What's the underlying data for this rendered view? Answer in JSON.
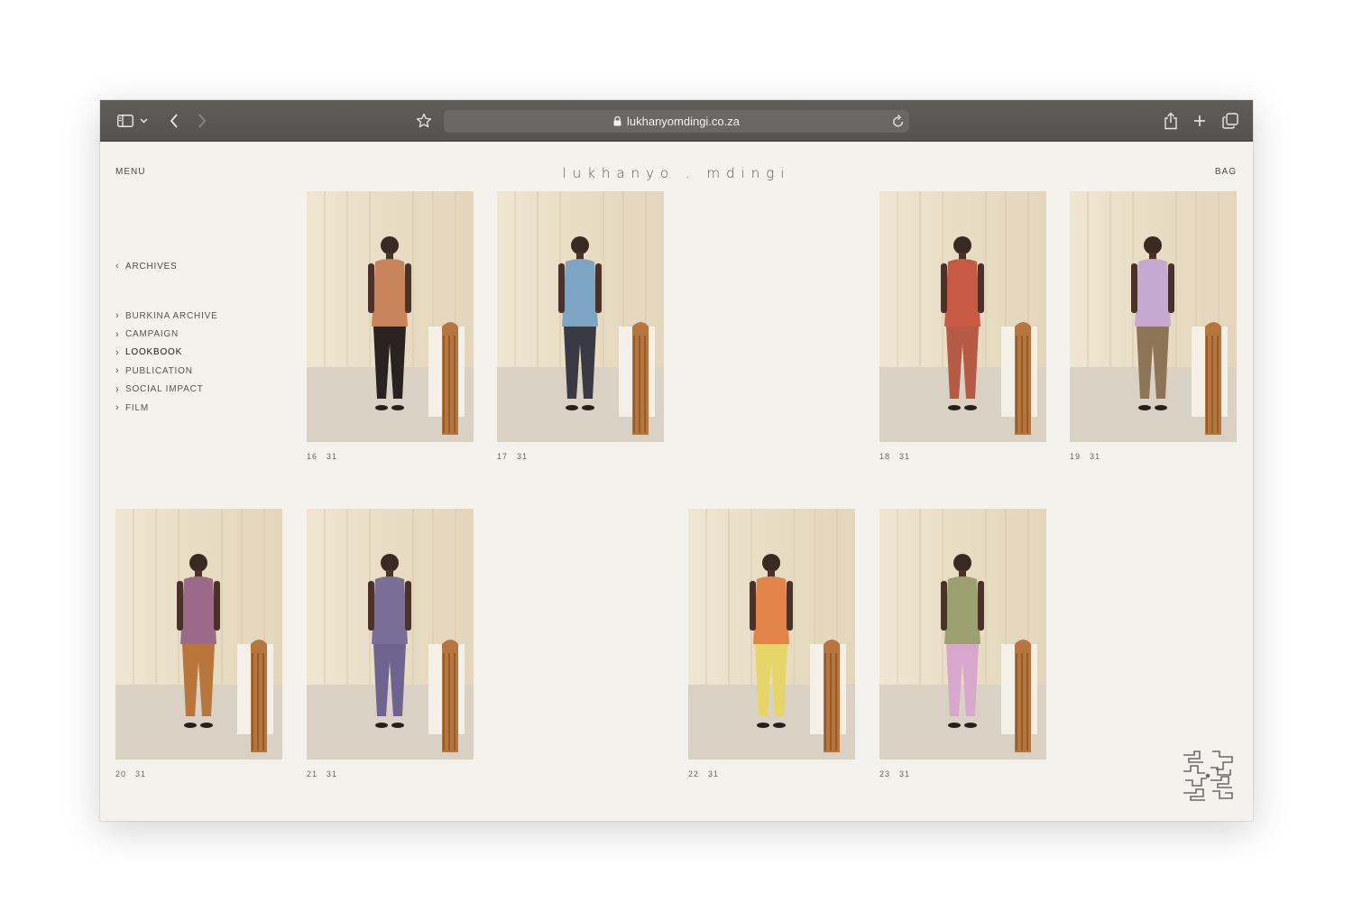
{
  "browser": {
    "url": "lukhanyomdingi.co.za",
    "icons": [
      "sidebar-icon",
      "chevron-down-icon",
      "back-icon",
      "forward-icon",
      "star-icon",
      "lock-icon",
      "reload-icon",
      "share-icon",
      "new-tab-icon",
      "tabs-overview-icon"
    ]
  },
  "header": {
    "menu_label": "MENU",
    "brand": "lukhanyo . mdingi",
    "bag_label": "BAG"
  },
  "sidebar": {
    "back_label": "ARCHIVES",
    "items": [
      {
        "label": "BURKINA ARCHIVE"
      },
      {
        "label": "CAMPAIGN"
      },
      {
        "label": "LOOKBOOK"
      },
      {
        "label": "PUBLICATION"
      },
      {
        "label": "SOCIAL IMPACT"
      },
      {
        "label": "FILM"
      }
    ],
    "active_index": 2
  },
  "gallery": {
    "total": "31",
    "photos": [
      {
        "index": "16",
        "total": "31",
        "outfit": "#c8835a",
        "accent": "#2a2220"
      },
      {
        "index": "17",
        "total": "31",
        "outfit": "#7ea4c4",
        "accent": "#3a3a44"
      },
      {
        "index": "18",
        "total": "31",
        "outfit": "#c65a45",
        "accent": "#b55a45"
      },
      {
        "index": "19",
        "total": "31",
        "outfit": "#c6a8d0",
        "accent": "#8c7456"
      },
      {
        "index": "20",
        "total": "31",
        "outfit": "#9a6a88",
        "accent": "#b8763c"
      },
      {
        "index": "21",
        "total": "31",
        "outfit": "#7a6e96",
        "accent": "#6f6490"
      },
      {
        "index": "22",
        "total": "31",
        "outfit": "#e2844a",
        "accent": "#e6d66a"
      },
      {
        "index": "23",
        "total": "31",
        "outfit": "#9aa070",
        "accent": "#d8a8cc"
      }
    ]
  },
  "colors": {
    "page_bg": "#f4f2ec",
    "toolbar_bg": "#5a5854",
    "backdrop": "#e8dcc4"
  }
}
